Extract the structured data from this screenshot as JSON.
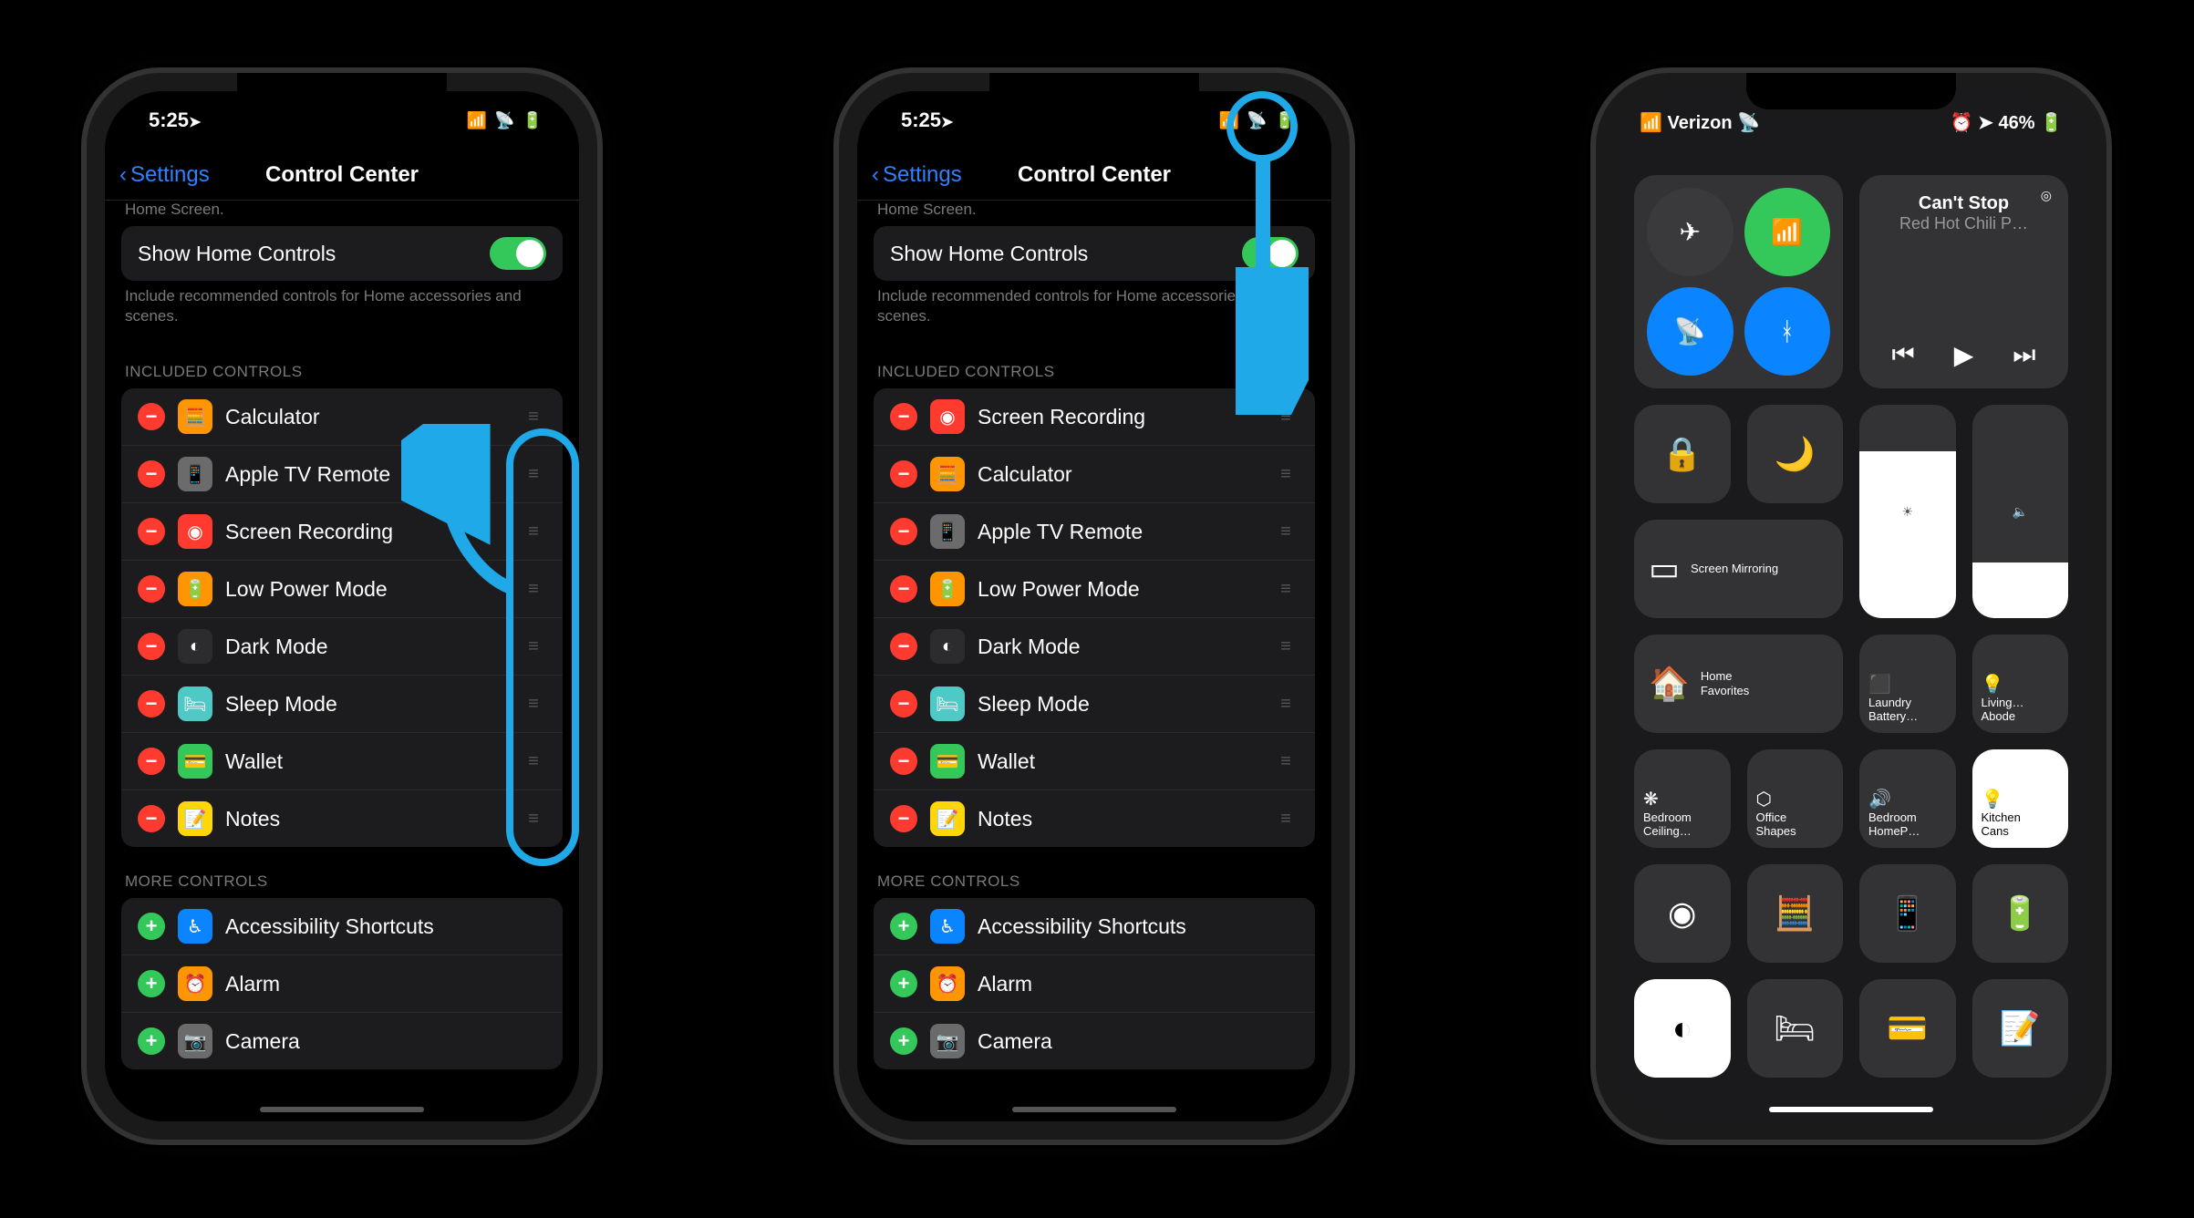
{
  "statusbar": {
    "time": "5:25",
    "arrow": "➤"
  },
  "nav": {
    "back": "Settings",
    "title": "Control Center"
  },
  "cutoff": "Home Screen.",
  "homeControls": {
    "label": "Show Home Controls",
    "caption": "Include recommended controls for Home accessories and scenes."
  },
  "sections": {
    "included": "INCLUDED CONTROLS",
    "more": "MORE CONTROLS"
  },
  "included1": [
    {
      "label": "Calculator",
      "bg": "#ff9500",
      "glyph": "🧮"
    },
    {
      "label": "Apple TV Remote",
      "bg": "#6b6b6b",
      "glyph": "📱"
    },
    {
      "label": "Screen Recording",
      "bg": "#ff3b30",
      "glyph": "◉"
    },
    {
      "label": "Low Power Mode",
      "bg": "#ff9500",
      "glyph": "🔋"
    },
    {
      "label": "Dark Mode",
      "bg": "#2c2c2e",
      "glyph": "◐"
    },
    {
      "label": "Sleep Mode",
      "bg": "#4fc9c5",
      "glyph": "🛏"
    },
    {
      "label": "Wallet",
      "bg": "#34c759",
      "glyph": "💳"
    },
    {
      "label": "Notes",
      "bg": "#ffd60a",
      "glyph": "📝"
    }
  ],
  "included2": [
    {
      "label": "Screen Recording",
      "bg": "#ff3b30",
      "glyph": "◉"
    },
    {
      "label": "Calculator",
      "bg": "#ff9500",
      "glyph": "🧮"
    },
    {
      "label": "Apple TV Remote",
      "bg": "#6b6b6b",
      "glyph": "📱"
    },
    {
      "label": "Low Power Mode",
      "bg": "#ff9500",
      "glyph": "🔋"
    },
    {
      "label": "Dark Mode",
      "bg": "#2c2c2e",
      "glyph": "◐"
    },
    {
      "label": "Sleep Mode",
      "bg": "#4fc9c5",
      "glyph": "🛏"
    },
    {
      "label": "Wallet",
      "bg": "#34c759",
      "glyph": "💳"
    },
    {
      "label": "Notes",
      "bg": "#ffd60a",
      "glyph": "📝"
    }
  ],
  "more": [
    {
      "label": "Accessibility Shortcuts",
      "bg": "#0a84ff",
      "glyph": "♿︎"
    },
    {
      "label": "Alarm",
      "bg": "#ff9500",
      "glyph": "⏰"
    },
    {
      "label": "Camera",
      "bg": "#6b6b6b",
      "glyph": "📷"
    }
  ],
  "phone3": {
    "carrier": "Verizon",
    "battery": "46%",
    "media": {
      "title": "Can't Stop",
      "artist": "Red Hot Chili P…"
    },
    "screen_mirroring": "Screen Mirroring",
    "home_favorites": {
      "l1": "Home",
      "l2": "Favorites"
    },
    "tiles_small": [
      {
        "l1": "Laundry",
        "l2": "Battery…"
      },
      {
        "l1": "Living…",
        "l2": "Abode"
      },
      {
        "l1": "Bedroom",
        "l2": "Ceiling…"
      },
      {
        "l1": "Office",
        "l2": "Shapes"
      },
      {
        "l1": "Bedroom",
        "l2": "HomeP…"
      },
      {
        "l1": "Kitchen",
        "l2": "Cans"
      }
    ]
  }
}
